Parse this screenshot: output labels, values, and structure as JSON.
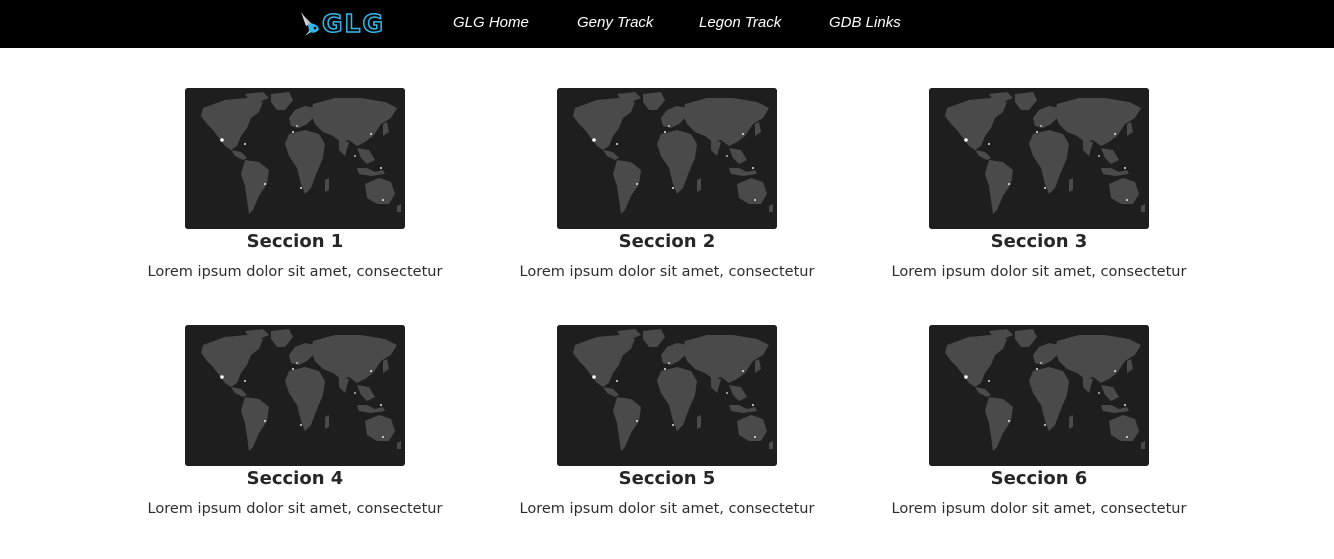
{
  "header": {
    "logo_text": "GLG",
    "logo_icon": "rocket-bird-icon",
    "nav": [
      {
        "label": "GLG Home"
      },
      {
        "label": "Geny Track"
      },
      {
        "label": "Legon Track"
      },
      {
        "label": "GDB Links"
      }
    ]
  },
  "colors": {
    "navbar_bg": "#000000",
    "logo_accent": "#35b6e6",
    "map_bg": "#1e1e1e",
    "map_land": "#4a4a4a"
  },
  "sections": [
    {
      "title": "Seccion 1",
      "text": "Lorem ipsum dolor sit amet, consectetur",
      "image": "world-map-icon"
    },
    {
      "title": "Seccion 2",
      "text": "Lorem ipsum dolor sit amet, consectetur",
      "image": "world-map-icon"
    },
    {
      "title": "Seccion 3",
      "text": "Lorem ipsum dolor sit amet, consectetur",
      "image": "world-map-icon"
    },
    {
      "title": "Seccion 4",
      "text": "Lorem ipsum dolor sit amet, consectetur",
      "image": "world-map-icon"
    },
    {
      "title": "Seccion 5",
      "text": "Lorem ipsum dolor sit amet, consectetur",
      "image": "world-map-icon"
    },
    {
      "title": "Seccion 6",
      "text": "Lorem ipsum dolor sit amet, consectetur",
      "image": "world-map-icon"
    }
  ]
}
